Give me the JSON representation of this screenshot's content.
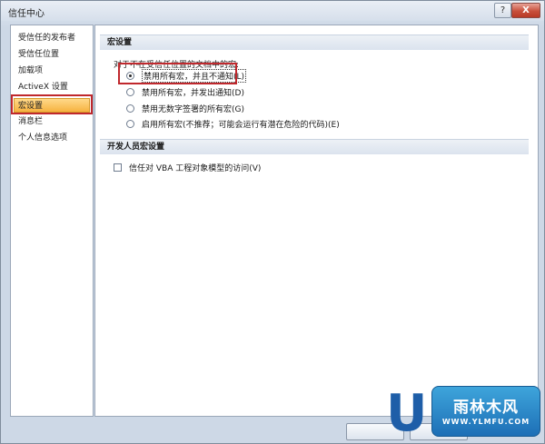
{
  "window": {
    "title": "信任中心",
    "help_label": "?",
    "close_label": "X"
  },
  "sidebar": {
    "items": [
      {
        "label": "受信任的发布者"
      },
      {
        "label": "受信任位置"
      },
      {
        "label": "加载项"
      },
      {
        "label": "ActiveX 设置"
      },
      {
        "label": "宏设置"
      },
      {
        "label": "消息栏"
      },
      {
        "label": "个人信息选项"
      }
    ],
    "selected": "宏设置"
  },
  "macro_settings": {
    "header": "宏设置",
    "caption": "对于不在受信任位置的文档中的宏:",
    "options": [
      {
        "label": "禁用所有宏，并且不通知(L)",
        "checked": true
      },
      {
        "label": "禁用所有宏，并发出通知(D)",
        "checked": false
      },
      {
        "label": "禁用无数字签署的所有宏(G)",
        "checked": false
      },
      {
        "label": "启用所有宏(不推荐；可能会运行有潜在危险的代码)(E)",
        "checked": false
      }
    ]
  },
  "developer_settings": {
    "header": "开发人员宏设置",
    "trust_vba_label": "信任对 VBA 工程对象模型的访问(V)",
    "trust_vba_checked": false
  },
  "watermark": {
    "letter": "U",
    "name": "雨林木风",
    "url": "WWW.YLMFU.COM"
  },
  "colors": {
    "highlight_border": "#c0282d",
    "selected_item": "#f6b240",
    "watermark_blue": "#1e5ea8"
  }
}
